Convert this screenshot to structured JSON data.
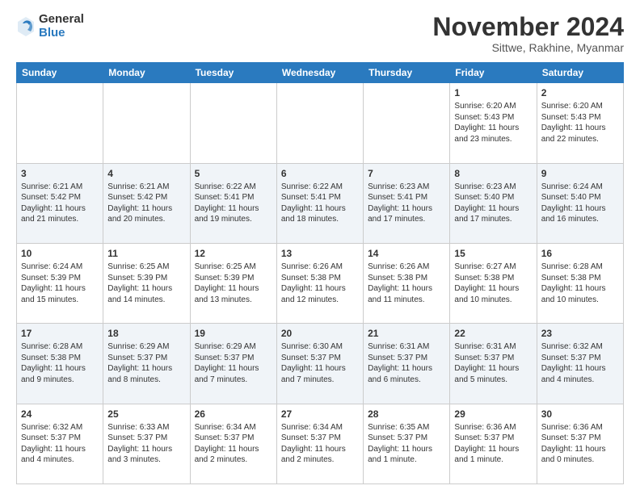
{
  "logo": {
    "general": "General",
    "blue": "Blue"
  },
  "title": "November 2024",
  "location": "Sittwe, Rakhine, Myanmar",
  "weekdays": [
    "Sunday",
    "Monday",
    "Tuesday",
    "Wednesday",
    "Thursday",
    "Friday",
    "Saturday"
  ],
  "weeks": [
    [
      {
        "day": "",
        "sunrise": "",
        "sunset": "",
        "daylight": ""
      },
      {
        "day": "",
        "sunrise": "",
        "sunset": "",
        "daylight": ""
      },
      {
        "day": "",
        "sunrise": "",
        "sunset": "",
        "daylight": ""
      },
      {
        "day": "",
        "sunrise": "",
        "sunset": "",
        "daylight": ""
      },
      {
        "day": "",
        "sunrise": "",
        "sunset": "",
        "daylight": ""
      },
      {
        "day": "1",
        "sunrise": "Sunrise: 6:20 AM",
        "sunset": "Sunset: 5:43 PM",
        "daylight": "Daylight: 11 hours and 23 minutes."
      },
      {
        "day": "2",
        "sunrise": "Sunrise: 6:20 AM",
        "sunset": "Sunset: 5:43 PM",
        "daylight": "Daylight: 11 hours and 22 minutes."
      }
    ],
    [
      {
        "day": "3",
        "sunrise": "Sunrise: 6:21 AM",
        "sunset": "Sunset: 5:42 PM",
        "daylight": "Daylight: 11 hours and 21 minutes."
      },
      {
        "day": "4",
        "sunrise": "Sunrise: 6:21 AM",
        "sunset": "Sunset: 5:42 PM",
        "daylight": "Daylight: 11 hours and 20 minutes."
      },
      {
        "day": "5",
        "sunrise": "Sunrise: 6:22 AM",
        "sunset": "Sunset: 5:41 PM",
        "daylight": "Daylight: 11 hours and 19 minutes."
      },
      {
        "day": "6",
        "sunrise": "Sunrise: 6:22 AM",
        "sunset": "Sunset: 5:41 PM",
        "daylight": "Daylight: 11 hours and 18 minutes."
      },
      {
        "day": "7",
        "sunrise": "Sunrise: 6:23 AM",
        "sunset": "Sunset: 5:41 PM",
        "daylight": "Daylight: 11 hours and 17 minutes."
      },
      {
        "day": "8",
        "sunrise": "Sunrise: 6:23 AM",
        "sunset": "Sunset: 5:40 PM",
        "daylight": "Daylight: 11 hours and 17 minutes."
      },
      {
        "day": "9",
        "sunrise": "Sunrise: 6:24 AM",
        "sunset": "Sunset: 5:40 PM",
        "daylight": "Daylight: 11 hours and 16 minutes."
      }
    ],
    [
      {
        "day": "10",
        "sunrise": "Sunrise: 6:24 AM",
        "sunset": "Sunset: 5:39 PM",
        "daylight": "Daylight: 11 hours and 15 minutes."
      },
      {
        "day": "11",
        "sunrise": "Sunrise: 6:25 AM",
        "sunset": "Sunset: 5:39 PM",
        "daylight": "Daylight: 11 hours and 14 minutes."
      },
      {
        "day": "12",
        "sunrise": "Sunrise: 6:25 AM",
        "sunset": "Sunset: 5:39 PM",
        "daylight": "Daylight: 11 hours and 13 minutes."
      },
      {
        "day": "13",
        "sunrise": "Sunrise: 6:26 AM",
        "sunset": "Sunset: 5:38 PM",
        "daylight": "Daylight: 11 hours and 12 minutes."
      },
      {
        "day": "14",
        "sunrise": "Sunrise: 6:26 AM",
        "sunset": "Sunset: 5:38 PM",
        "daylight": "Daylight: 11 hours and 11 minutes."
      },
      {
        "day": "15",
        "sunrise": "Sunrise: 6:27 AM",
        "sunset": "Sunset: 5:38 PM",
        "daylight": "Daylight: 11 hours and 10 minutes."
      },
      {
        "day": "16",
        "sunrise": "Sunrise: 6:28 AM",
        "sunset": "Sunset: 5:38 PM",
        "daylight": "Daylight: 11 hours and 10 minutes."
      }
    ],
    [
      {
        "day": "17",
        "sunrise": "Sunrise: 6:28 AM",
        "sunset": "Sunset: 5:38 PM",
        "daylight": "Daylight: 11 hours and 9 minutes."
      },
      {
        "day": "18",
        "sunrise": "Sunrise: 6:29 AM",
        "sunset": "Sunset: 5:37 PM",
        "daylight": "Daylight: 11 hours and 8 minutes."
      },
      {
        "day": "19",
        "sunrise": "Sunrise: 6:29 AM",
        "sunset": "Sunset: 5:37 PM",
        "daylight": "Daylight: 11 hours and 7 minutes."
      },
      {
        "day": "20",
        "sunrise": "Sunrise: 6:30 AM",
        "sunset": "Sunset: 5:37 PM",
        "daylight": "Daylight: 11 hours and 7 minutes."
      },
      {
        "day": "21",
        "sunrise": "Sunrise: 6:31 AM",
        "sunset": "Sunset: 5:37 PM",
        "daylight": "Daylight: 11 hours and 6 minutes."
      },
      {
        "day": "22",
        "sunrise": "Sunrise: 6:31 AM",
        "sunset": "Sunset: 5:37 PM",
        "daylight": "Daylight: 11 hours and 5 minutes."
      },
      {
        "day": "23",
        "sunrise": "Sunrise: 6:32 AM",
        "sunset": "Sunset: 5:37 PM",
        "daylight": "Daylight: 11 hours and 4 minutes."
      }
    ],
    [
      {
        "day": "24",
        "sunrise": "Sunrise: 6:32 AM",
        "sunset": "Sunset: 5:37 PM",
        "daylight": "Daylight: 11 hours and 4 minutes."
      },
      {
        "day": "25",
        "sunrise": "Sunrise: 6:33 AM",
        "sunset": "Sunset: 5:37 PM",
        "daylight": "Daylight: 11 hours and 3 minutes."
      },
      {
        "day": "26",
        "sunrise": "Sunrise: 6:34 AM",
        "sunset": "Sunset: 5:37 PM",
        "daylight": "Daylight: 11 hours and 2 minutes."
      },
      {
        "day": "27",
        "sunrise": "Sunrise: 6:34 AM",
        "sunset": "Sunset: 5:37 PM",
        "daylight": "Daylight: 11 hours and 2 minutes."
      },
      {
        "day": "28",
        "sunrise": "Sunrise: 6:35 AM",
        "sunset": "Sunset: 5:37 PM",
        "daylight": "Daylight: 11 hours and 1 minute."
      },
      {
        "day": "29",
        "sunrise": "Sunrise: 6:36 AM",
        "sunset": "Sunset: 5:37 PM",
        "daylight": "Daylight: 11 hours and 1 minute."
      },
      {
        "day": "30",
        "sunrise": "Sunrise: 6:36 AM",
        "sunset": "Sunset: 5:37 PM",
        "daylight": "Daylight: 11 hours and 0 minutes."
      }
    ]
  ]
}
